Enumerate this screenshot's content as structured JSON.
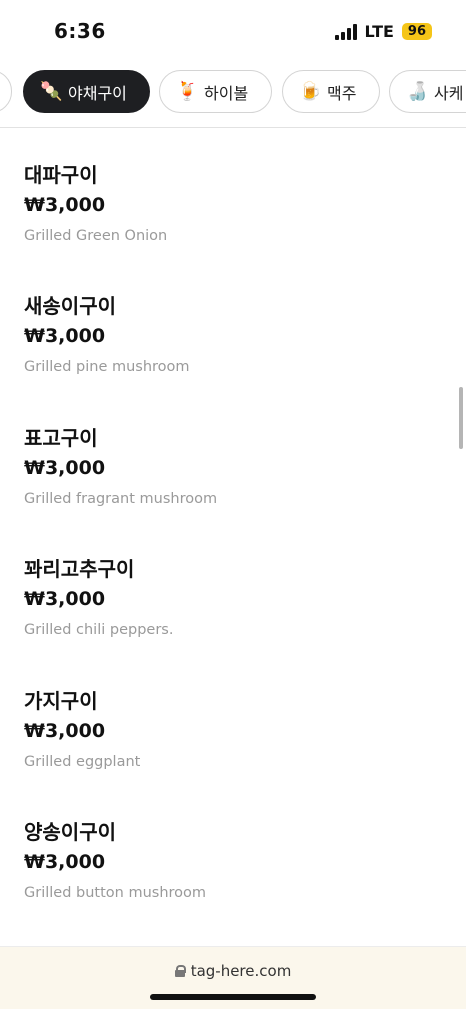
{
  "status_bar": {
    "time": "6:36",
    "network": "LTE",
    "battery": "96"
  },
  "tabs": [
    {
      "label": "",
      "emoji": ""
    },
    {
      "label": "야채구이",
      "emoji": "🍡",
      "active": true
    },
    {
      "label": "하이볼",
      "emoji": "🍹"
    },
    {
      "label": "맥주",
      "emoji": "🍺"
    },
    {
      "label": "사케",
      "emoji": "🍶"
    }
  ],
  "menu": {
    "items": [
      {
        "name": "대파구이",
        "price": "₩3,000",
        "description": "Grilled Green Onion"
      },
      {
        "name": "새송이구이",
        "price": "₩3,000",
        "description": "Grilled pine mushroom"
      },
      {
        "name": "표고구이",
        "price": "₩3,000",
        "description": "Grilled fragrant mushroom"
      },
      {
        "name": "꽈리고추구이",
        "price": "₩3,000",
        "description": "Grilled chili peppers."
      },
      {
        "name": "가지구이",
        "price": "₩3,000",
        "description": "Grilled eggplant"
      },
      {
        "name": "양송이구이",
        "price": "₩3,000",
        "description": "Grilled button mushroom"
      }
    ]
  },
  "browser": {
    "url": "tag-here.com"
  }
}
